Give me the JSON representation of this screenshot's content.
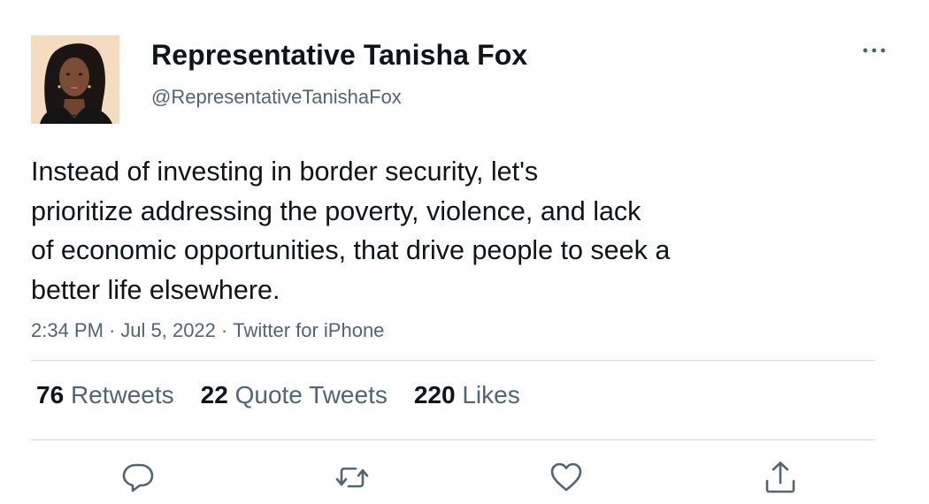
{
  "author": {
    "display_name": "Representative Tanisha Fox",
    "handle": "@RepresentativeTanishaFox",
    "avatar_icon": "profile-photo"
  },
  "tweet": {
    "text": "Instead of investing in border security, let's\nprioritize addressing the poverty, violence, and lack\nof economic opportunities, that drive people to seek a\nbetter life elsewhere.",
    "time": "2:34 PM",
    "date": "Jul 5, 2022",
    "source": "Twitter for iPhone",
    "separator": "·"
  },
  "stats": {
    "retweets": {
      "count": "76",
      "label": "Retweets"
    },
    "quote_tweets": {
      "count": "22",
      "label": "Quote Tweets"
    },
    "likes": {
      "count": "220",
      "label": "Likes"
    }
  },
  "actions": [
    {
      "name": "reply",
      "icon": "reply-icon"
    },
    {
      "name": "retweet",
      "icon": "retweet-icon"
    },
    {
      "name": "like",
      "icon": "heart-icon"
    },
    {
      "name": "share",
      "icon": "share-icon"
    }
  ],
  "colors": {
    "text": "#0f1419",
    "secondary": "#536471",
    "divider": "#cfd9de",
    "background": "#ffffff"
  }
}
